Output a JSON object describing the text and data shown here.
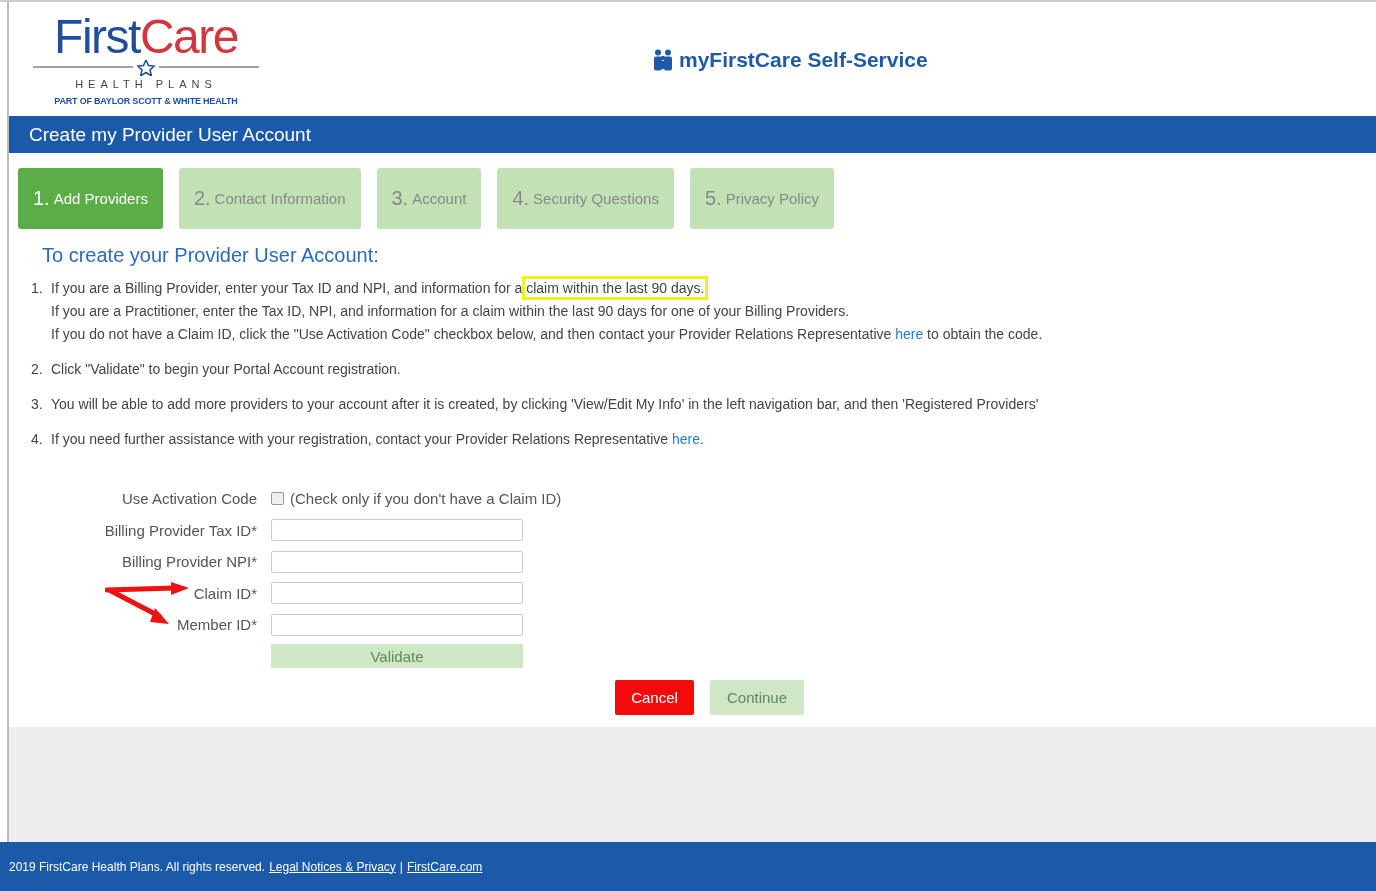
{
  "logo": {
    "brand_first": "First",
    "brand_second": "Care",
    "tagline": "HEALTH PLANS",
    "subtitle": "PART OF BAYLOR SCOTT & WHITE HEALTH"
  },
  "portal_title": "myFirstCare Self-Service",
  "page_title": "Create my Provider User Account",
  "steps": [
    {
      "number": "1.",
      "label": "Add Providers",
      "selected": true
    },
    {
      "number": "2.",
      "label": "Contact Information",
      "selected": false
    },
    {
      "number": "3.",
      "label": "Account",
      "selected": false
    },
    {
      "number": "4.",
      "label": "Security Questions",
      "selected": false
    },
    {
      "number": "5.",
      "label": "Privacy Policy",
      "selected": false
    }
  ],
  "heading": "To create your Provider User Account:",
  "instructions": [
    {
      "number": "1.",
      "lines": [
        [
          {
            "kind": "plain",
            "text": "If you are a Billing Provider, enter your Tax ID and NPI, and information for a "
          },
          {
            "kind": "highlight",
            "text": "claim within the last 90 days."
          }
        ],
        [
          {
            "kind": "plain",
            "text": "If you are a Practitioner, enter the Tax ID, NPI, and information for a claim within the last 90 days for one of your Billing Providers."
          }
        ],
        [
          {
            "kind": "plain",
            "text": "If you do not have a Claim ID, click the \"Use Activation Code\" checkbox below, and then contact your Provider Relations Representative "
          },
          {
            "kind": "link",
            "text": "here"
          },
          {
            "kind": "plain",
            "text": " to obtain the code."
          }
        ]
      ]
    },
    {
      "number": "2.",
      "lines": [
        [
          {
            "kind": "plain",
            "text": "Click \"Validate\" to begin your Portal Account registration."
          }
        ]
      ]
    },
    {
      "number": "3.",
      "lines": [
        [
          {
            "kind": "plain",
            "text": "You will be able to add more providers to your account after it is created, by clicking 'View/Edit My Info' in the left navigation bar, and then 'Registered Providers'"
          }
        ]
      ]
    },
    {
      "number": "4.",
      "lines": [
        [
          {
            "kind": "plain",
            "text": "If you need further assistance with your registration, contact your Provider Relations Representative "
          },
          {
            "kind": "link",
            "text": "here"
          },
          {
            "kind": "plain",
            "text": "."
          }
        ]
      ]
    }
  ],
  "activation": {
    "label": "Use Activation Code",
    "checked": false,
    "note": "(Check only if you don't have a Claim ID)"
  },
  "fields": [
    {
      "label": "Billing Provider Tax ID*"
    },
    {
      "label": "Billing Provider NPI*"
    },
    {
      "label": "Claim ID*"
    },
    {
      "label": "Member ID*"
    }
  ],
  "validate_button": {
    "label": "Validate",
    "disabled": true
  },
  "cancel_button": {
    "label": "Cancel",
    "disabled": false
  },
  "continue_button": {
    "label": "Continue",
    "disabled": true
  },
  "footer": {
    "text": "2019 FirstCare Health Plans. All rights reserved.",
    "links": [
      "Legal Notices & Privacy",
      "FirstCare.com"
    ],
    "separator": "|"
  }
}
